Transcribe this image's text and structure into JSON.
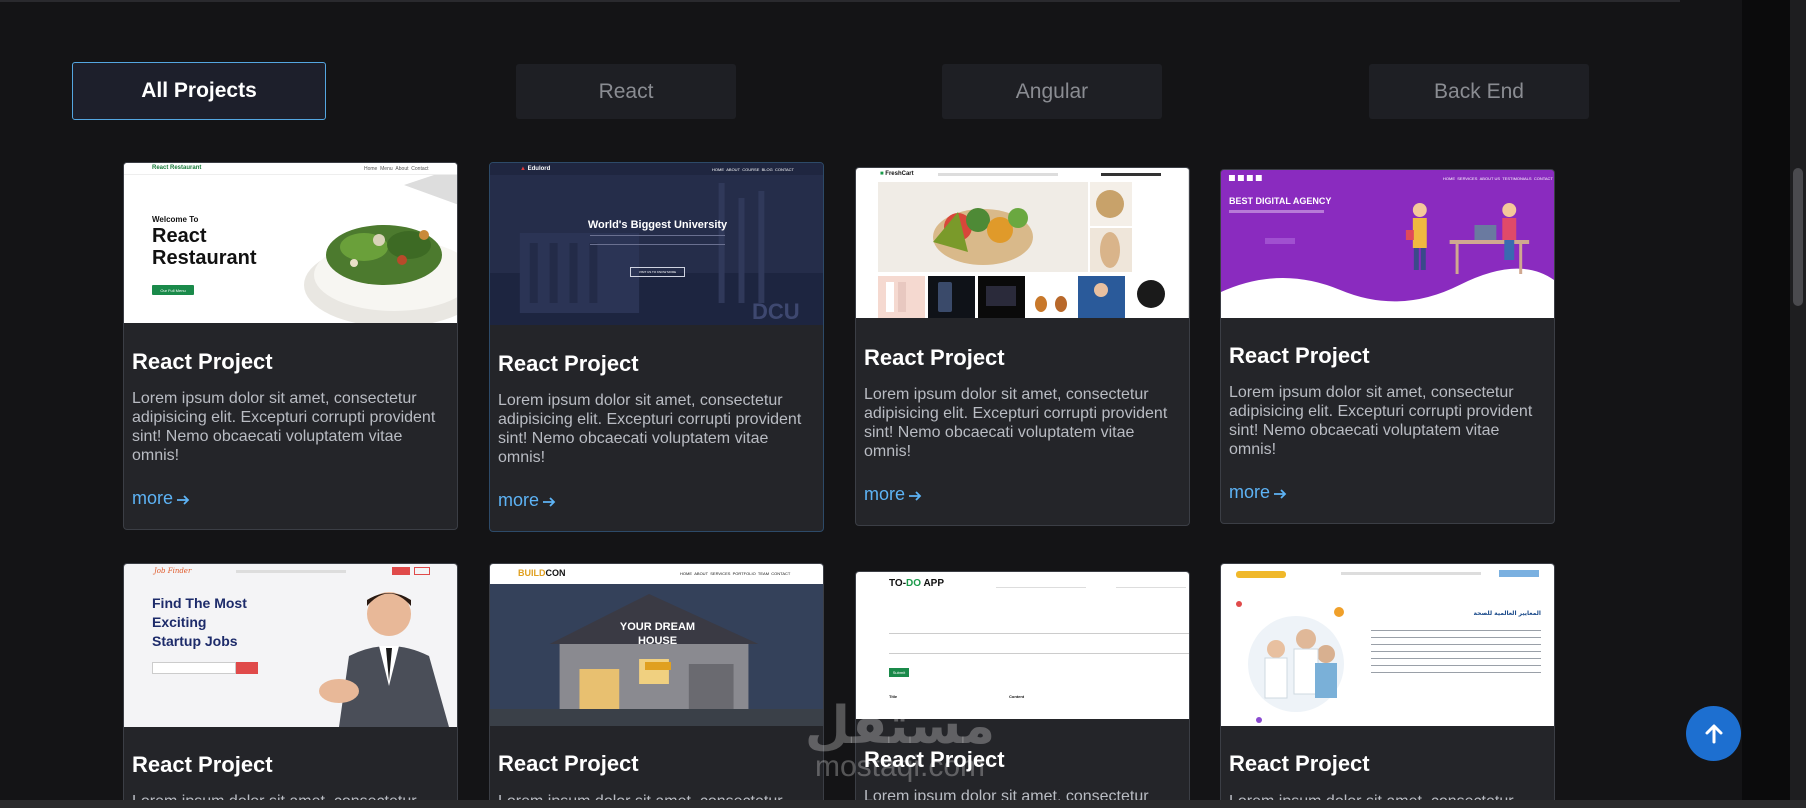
{
  "filters": {
    "tabs": [
      {
        "label": "All Projects",
        "active": true
      },
      {
        "label": "React",
        "active": false
      },
      {
        "label": "Angular",
        "active": false
      },
      {
        "label": "Back End",
        "active": false
      }
    ]
  },
  "projects": [
    {
      "title": "React Project",
      "description": "Lorem ipsum dolor sit amet, consectetur adipisicing elit. Excepturi corrupti provident sint! Nemo obcaecati voluptatem vitae omnis!",
      "more": "more",
      "thumb": {
        "brand": "React Restaurant",
        "nav": [
          "Home",
          "Menu",
          "About",
          "Contact"
        ],
        "welcome": "Welcome To",
        "heading1": "React",
        "heading2": "Restaurant",
        "button": "Our Full Menu"
      }
    },
    {
      "title": "React Project",
      "description": "Lorem ipsum dolor sit amet, consectetur adipisicing elit. Excepturi corrupti provident sint! Nemo obcaecati voluptatem vitae omnis!",
      "more": "more",
      "thumb": {
        "brand": "Edulord",
        "nav": [
          "HOME",
          "ABOUT",
          "COURSE",
          "BLOG",
          "CONTACT"
        ],
        "heading": "World's Biggest University",
        "button": "VISIT US TO KNOW MORE",
        "mark": "DCU"
      }
    },
    {
      "title": "React Project",
      "description": "Lorem ipsum dolor sit amet, consectetur adipisicing elit. Excepturi corrupti provident sint! Nemo obcaecati voluptatem vitae omnis!",
      "more": "more",
      "thumb": {
        "brand": "FreshCart"
      }
    },
    {
      "title": "React Project",
      "description": "Lorem ipsum dolor sit amet, consectetur adipisicing elit. Excepturi corrupti provident sint! Nemo obcaecati voluptatem vitae omnis!",
      "more": "more",
      "thumb": {
        "heading": "BEST DIGITAL AGENCY",
        "nav": [
          "HOME",
          "SERVICES",
          "ABOUT US",
          "TESTIMONIALS",
          "CONTACT"
        ]
      }
    },
    {
      "title": "React Project",
      "description": "Lorem ipsum dolor sit amet, consectetur",
      "more": "more",
      "thumb": {
        "brand": "Job Finder",
        "heading1": "Find The Most",
        "heading2": "Exciting",
        "heading3": "Startup Jobs"
      }
    },
    {
      "title": "React Project",
      "description": "Lorem ipsum dolor sit amet, consectetur",
      "more": "more",
      "thumb": {
        "brand1": "BUILD",
        "brand2": "CON",
        "nav": [
          "HOME",
          "ABOUT",
          "SERVICES",
          "PORTFOLIO",
          "TEAM",
          "CONTACT"
        ],
        "heading1": "YOUR DREAM",
        "heading2": "HOUSE"
      }
    },
    {
      "title": "React Project",
      "description": "Lorem ipsum dolor sit amet, consectetur",
      "more": "more",
      "thumb": {
        "brand1": "TO-",
        "brand2": "DO",
        "brand3": " APP",
        "button": "Submit",
        "col1": "Title",
        "col2": "Content"
      }
    },
    {
      "title": "React Project",
      "description": "Lorem ipsum dolor sit amet, consectetur",
      "more": "more",
      "thumb": {
        "heading": "المعايير العالمية للصحة"
      }
    }
  ],
  "watermark": {
    "logo": "مستقل",
    "site": "mostaqi.com"
  },
  "colors": {
    "accent": "#5db3f5",
    "active_border": "#54a6e0",
    "to_top": "#1d6fd0"
  }
}
